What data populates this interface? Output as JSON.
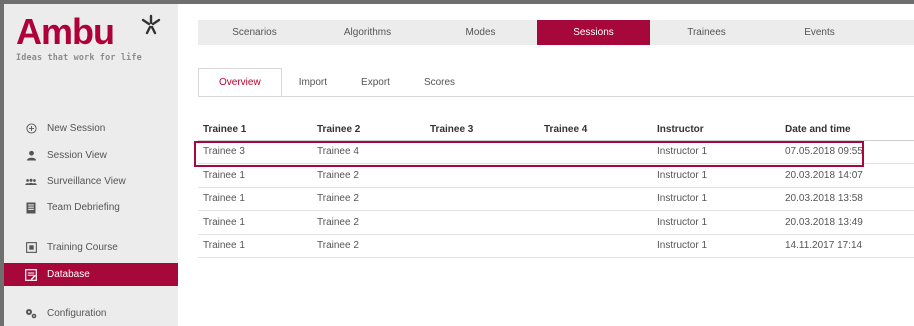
{
  "brand": {
    "name": "Ambu",
    "tagline": "Ideas that work for life",
    "color": "#a6083b"
  },
  "sidebar": {
    "items": [
      {
        "label": "New Session",
        "icon": "plus-circle-icon"
      },
      {
        "label": "Session View",
        "icon": "user-icon"
      },
      {
        "label": "Surveillance View",
        "icon": "group-icon"
      },
      {
        "label": "Team Debriefing",
        "icon": "book-icon"
      },
      {
        "label": "Training Course",
        "icon": "course-icon"
      },
      {
        "label": "Database",
        "icon": "database-icon",
        "active": true
      },
      {
        "label": "Configuration",
        "icon": "gears-icon"
      }
    ]
  },
  "topnav": {
    "tabs": [
      "Scenarios",
      "Algorithms",
      "Modes",
      "Sessions",
      "Trainees",
      "Events"
    ],
    "active": "Sessions"
  },
  "subnav": {
    "tabs": [
      "Overview",
      "Import",
      "Export",
      "Scores"
    ],
    "active": "Overview"
  },
  "table": {
    "headers": [
      "Trainee 1",
      "Trainee 2",
      "Trainee 3",
      "Trainee 4",
      "Instructor",
      "Date and time"
    ],
    "rows": [
      [
        "Trainee 3",
        "Trainee 4",
        "",
        "",
        "Instructor 1",
        "07.05.2018 09:55"
      ],
      [
        "Trainee 1",
        "Trainee 2",
        "",
        "",
        "Instructor 1",
        "20.03.2018 14:07"
      ],
      [
        "Trainee 1",
        "Trainee 2",
        "",
        "",
        "Instructor 1",
        "20.03.2018 13:58"
      ],
      [
        "Trainee 1",
        "Trainee 2",
        "",
        "",
        "Instructor 1",
        "20.03.2018 13:49"
      ],
      [
        "Trainee 1",
        "Trainee 2",
        "",
        "",
        "Instructor 1",
        "14.11.2017 17:14"
      ]
    ],
    "highlighted_row": 0
  }
}
